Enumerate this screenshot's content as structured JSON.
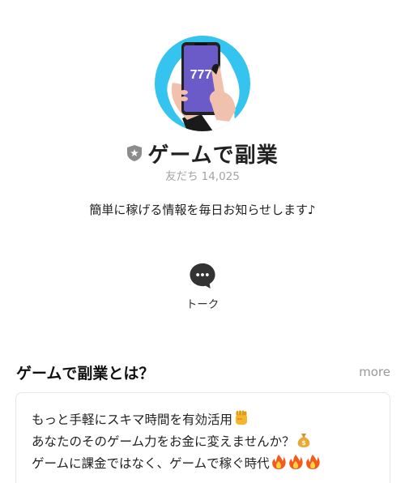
{
  "profile": {
    "avatar_icon": "smartphone-slot-777-icon",
    "avatar_text": "777",
    "badge_icon": "shield-star-icon",
    "account_name": "ゲームで副業",
    "friends_label": "友だち",
    "friends_count": "14,025",
    "status_message": "簡単に稼げる情報を毎日お知らせします♪"
  },
  "actions": {
    "talk_icon": "chat-bubble-icon",
    "talk_label": "トーク"
  },
  "section": {
    "title": "ゲームで副業とは？",
    "more_label": "more",
    "lines": [
      "もっと手軽にスキマ時間を有効活用",
      "あなたのそのゲーム力をお金に変えませんか？",
      "ゲームに課金ではなく、ゲームで稼ぐ時代"
    ],
    "emoji": [
      "raised-fist-icon",
      "money-bag-icon",
      "fire-icon"
    ]
  },
  "colors": {
    "avatar_bg": "#35c3f0",
    "phone_screen": "#6a5bc9",
    "text": "#1e1e1e",
    "muted": "#a3a3a3"
  }
}
